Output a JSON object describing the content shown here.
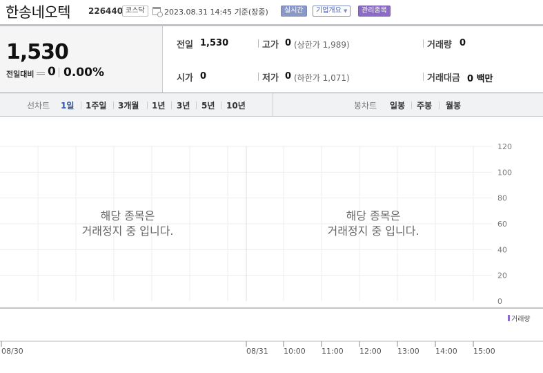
{
  "header": {
    "name": "한송네오텍",
    "code": "226440",
    "market": "코스닥",
    "date": "2023.08.31 14:45",
    "date_suffix": "기준(장중)",
    "realtime_label": "실시간",
    "company_label": "기업개요",
    "managed_label": "관리종목"
  },
  "quote": {
    "price": "1,530",
    "change_label": "전일대비",
    "change_value": "0",
    "change_pct": "0.00%",
    "prev_label": "전일",
    "prev_value": "1,530",
    "high_label": "고가",
    "high_value": "0",
    "upper_limit": "(상한가 1,989)",
    "volume_label": "거래량",
    "volume_value": "0",
    "open_label": "시가",
    "open_value": "0",
    "low_label": "저가",
    "low_value": "0",
    "lower_limit": "(하한가 1,071)",
    "amount_label": "거래대금",
    "amount_value": "0 백만"
  },
  "tabs": {
    "line_label": "선차트",
    "line_items": [
      "1일",
      "1주일",
      "3개월",
      "1년",
      "3년",
      "5년",
      "10년"
    ],
    "candle_label": "봉차트",
    "candle_items": [
      "일봉",
      "주봉",
      "월봉"
    ]
  },
  "chart_data": {
    "type": "line",
    "message_left": [
      "해당 종목은",
      "거래정지 중 입니다."
    ],
    "message_right": [
      "해당 종목은",
      "거래정지 중 입니다."
    ],
    "y_ticks": [
      "120",
      "100",
      "80",
      "60",
      "40",
      "20",
      "0"
    ],
    "ylim": [
      0,
      120
    ],
    "volume_label": "거래량",
    "x_ticks": [
      "08/30",
      "08/31",
      "10:00",
      "11:00",
      "12:00",
      "13:00",
      "14:00",
      "15:00"
    ],
    "grid": true,
    "series": []
  }
}
